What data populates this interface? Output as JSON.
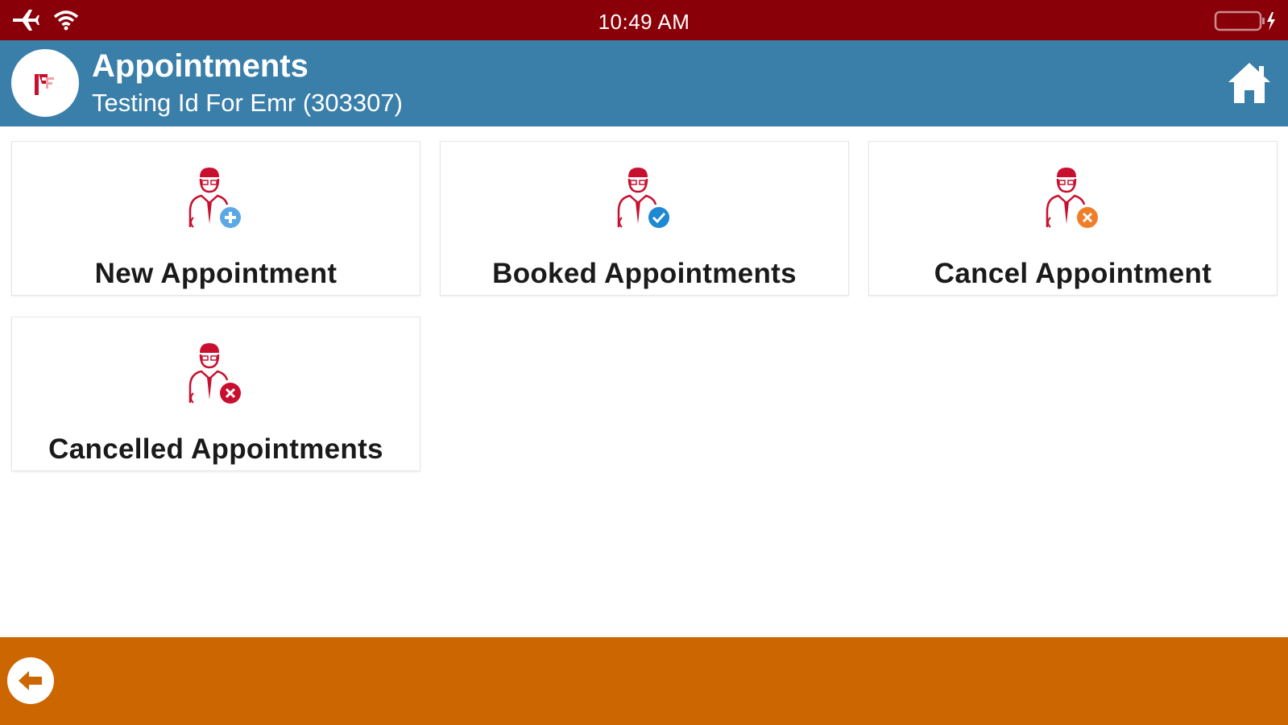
{
  "status_bar": {
    "time": "10:49 AM",
    "icons": [
      "airplane-icon",
      "wifi-icon",
      "battery-charging-icon"
    ]
  },
  "header": {
    "title": "Appointments",
    "subtitle": "Testing Id For Emr (303307)",
    "logo_icon": "app-logo",
    "home_icon": "home-icon"
  },
  "tiles": [
    {
      "label": "New Appointment",
      "icon": "doctor-add-icon",
      "badge_color": "#5aa9e6"
    },
    {
      "label": "Booked Appointments",
      "icon": "doctor-check-icon",
      "badge_color": "#1e88d2"
    },
    {
      "label": "Cancel Appointment",
      "icon": "doctor-cancel-icon",
      "badge_color": "#f07d2a"
    },
    {
      "label": "Cancelled Appointments",
      "icon": "doctor-cancelled-icon",
      "badge_color": "#c8102e"
    }
  ],
  "footer": {
    "back_icon": "back-arrow-icon"
  },
  "colors": {
    "status_bar": "#8a0008",
    "header": "#3a7faa",
    "footer": "#cc6600",
    "icon_red": "#c8102e"
  }
}
